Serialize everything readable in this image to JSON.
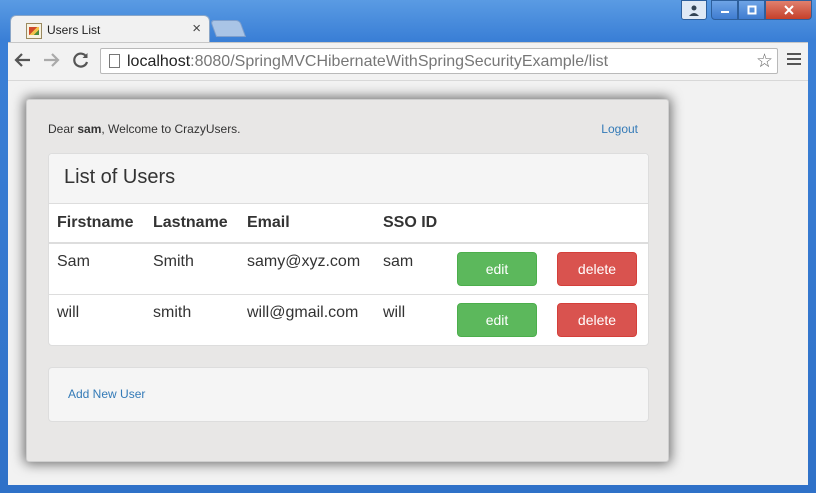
{
  "browser": {
    "tab_title": "Users List",
    "tab_close": "×",
    "url_host": "localhost",
    "url_rest": ":8080/SpringMVCHibernateWithSpringSecurityExample/list"
  },
  "auth": {
    "greeting_prefix": "Dear ",
    "username": "sam",
    "greeting_suffix": ", Welcome to CrazyUsers.",
    "logout_label": "Logout"
  },
  "panel": {
    "title": "List of Users",
    "columns": [
      "Firstname",
      "Lastname",
      "Email",
      "SSO ID"
    ],
    "rows": [
      {
        "firstname": "Sam",
        "lastname": "Smith",
        "email": "samy@xyz.com",
        "sso_id": "sam",
        "edit_label": "edit",
        "delete_label": "delete"
      },
      {
        "firstname": "will",
        "lastname": "smith",
        "email": "will@gmail.com",
        "sso_id": "will",
        "edit_label": "edit",
        "delete_label": "delete"
      }
    ]
  },
  "footer": {
    "add_user_label": "Add New User"
  },
  "colors": {
    "primary_link": "#337ab7",
    "edit_button": "#5cb85c",
    "delete_button": "#d9534f"
  }
}
